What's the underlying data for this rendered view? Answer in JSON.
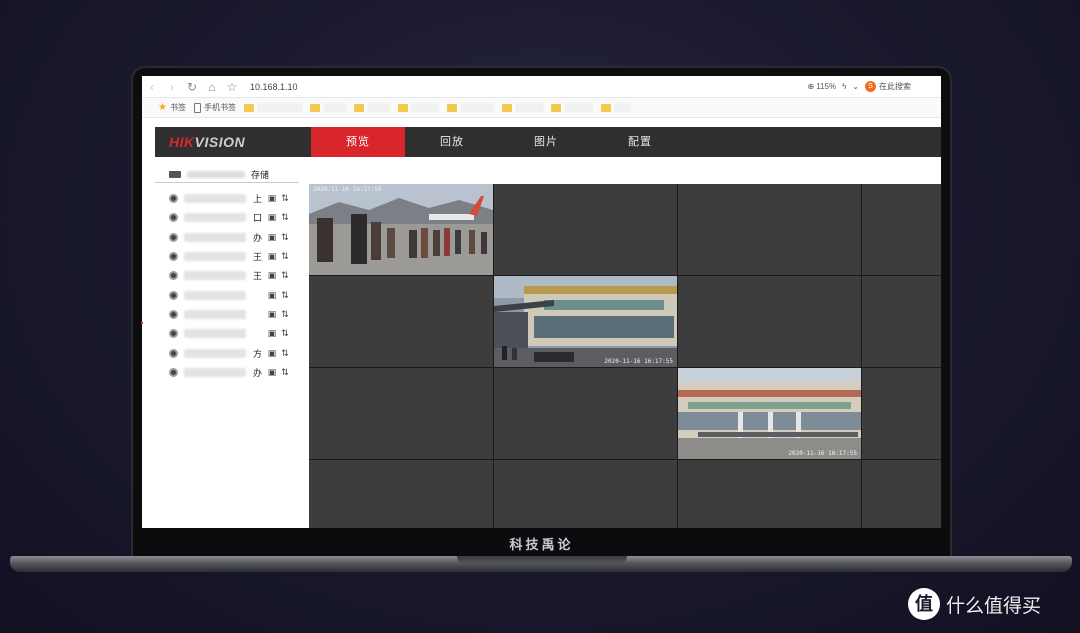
{
  "browser": {
    "url": "10.168.1.10",
    "zoom": "115%",
    "search_label": "在此搜索",
    "search_engine_glyph": "S",
    "bookmarks": [
      {
        "label": "书签",
        "icon": "star-icon"
      },
      {
        "label": "手机书签",
        "icon": "phone-icon"
      }
    ]
  },
  "app": {
    "logo_red": "HIK",
    "logo_grey": "VISION",
    "nav": [
      "预览",
      "回放",
      "图片",
      "配置"
    ],
    "active_nav": "预览",
    "storage_label": "存储",
    "cameras": [
      {
        "suffix": "上"
      },
      {
        "suffix": "口"
      },
      {
        "suffix": "办"
      },
      {
        "suffix": "王"
      },
      {
        "suffix": "王"
      },
      {
        "suffix": ""
      },
      {
        "suffix": ""
      },
      {
        "suffix": ""
      },
      {
        "suffix": "方"
      },
      {
        "suffix": "办"
      }
    ]
  },
  "feeds": {
    "cam1_timestamp": "2020-11-16 16:17:55",
    "cam2_timestamp": "2020-11-16 16:17:55",
    "cam3_timestamp": "2020-11-16 16:17:55"
  },
  "laptop": {
    "brand": "科技禹论"
  },
  "watermark": {
    "glyph": "值",
    "text": "什么值得买"
  },
  "colors": {
    "accent": "#d9262c",
    "header": "#2f2f2f",
    "grid_cell": "#3d3d3d"
  }
}
